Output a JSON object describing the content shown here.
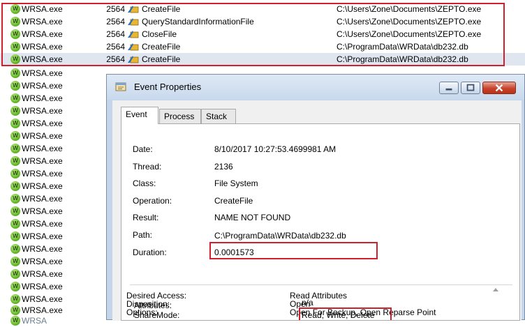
{
  "list": {
    "highlighted_rows": [
      {
        "process": "WRSA.exe",
        "pid": "2564",
        "operation": "CreateFile",
        "path": "C:\\Users\\Zone\\Documents\\ZEPTO.exe"
      },
      {
        "process": "WRSA.exe",
        "pid": "2564",
        "operation": "QueryStandardInformationFile",
        "path": "C:\\Users\\Zone\\Documents\\ZEPTO.exe"
      },
      {
        "process": "WRSA.exe",
        "pid": "2564",
        "operation": "CloseFile",
        "path": "C:\\Users\\Zone\\Documents\\ZEPTO.exe"
      },
      {
        "process": "WRSA.exe",
        "pid": "2564",
        "operation": "CreateFile",
        "path": "C:\\ProgramData\\WRData\\db232.db"
      },
      {
        "process": "WRSA.exe",
        "pid": "2564",
        "operation": "CreateFile",
        "path": "C:\\ProgramData\\WRData\\db232.db"
      }
    ],
    "other_rows": [
      "WRSA.exe",
      "WRSA.exe",
      "WRSA.exe",
      "WRSA.exe",
      "WRSA.exe",
      "WRSA.exe",
      "WRSA.exe",
      "WRSA.exe",
      "WRSA.exe",
      "WRSA.exe",
      "WRSA.exe",
      "WRSA.exe",
      "WRSA.exe",
      "WRSA.exe",
      "WRSA.exe",
      "WRSA.exe",
      "WRSA.exe",
      "WRSA.exe",
      "WRSA.exe",
      "WRSA.exe"
    ],
    "cutoff_row": "WRSA"
  },
  "dialog": {
    "title": "Event Properties",
    "tabs": [
      "Event",
      "Process",
      "Stack"
    ],
    "active_tab": "Event",
    "properties": {
      "date_label": "Date:",
      "date": "8/10/2017 10:27:53.4699981 AM",
      "thread_label": "Thread:",
      "thread": "2136",
      "class_label": "Class:",
      "class": "File System",
      "operation_label": "Operation:",
      "operation": "CreateFile",
      "result_label": "Result:",
      "result": "NAME NOT FOUND",
      "path_label": "Path:",
      "path": "C:\\ProgramData\\WRData\\db232.db",
      "duration_label": "Duration:",
      "duration": "0.0001573"
    },
    "details": [
      {
        "label": "Desired Access:",
        "value": "Read Attributes"
      },
      {
        "label": "Disposition:",
        "value": "Open"
      },
      {
        "label": "Options:",
        "value": "Open For Backup, Open Reparse Point"
      },
      {
        "label": "Attributes:",
        "value": "n/a"
      },
      {
        "label": "ShareMode:",
        "value": "Read, Write, Delete"
      }
    ]
  },
  "colors": {
    "highlight_box": "#d0202e",
    "selected_row": "#dfe6ef",
    "dialog_frame": "#c5d6ea",
    "close_button": "#c7422c"
  },
  "icons": {
    "process": "wrsa-process-icon",
    "operation": "file-system-operation-icon",
    "window": "event-properties-icon"
  }
}
